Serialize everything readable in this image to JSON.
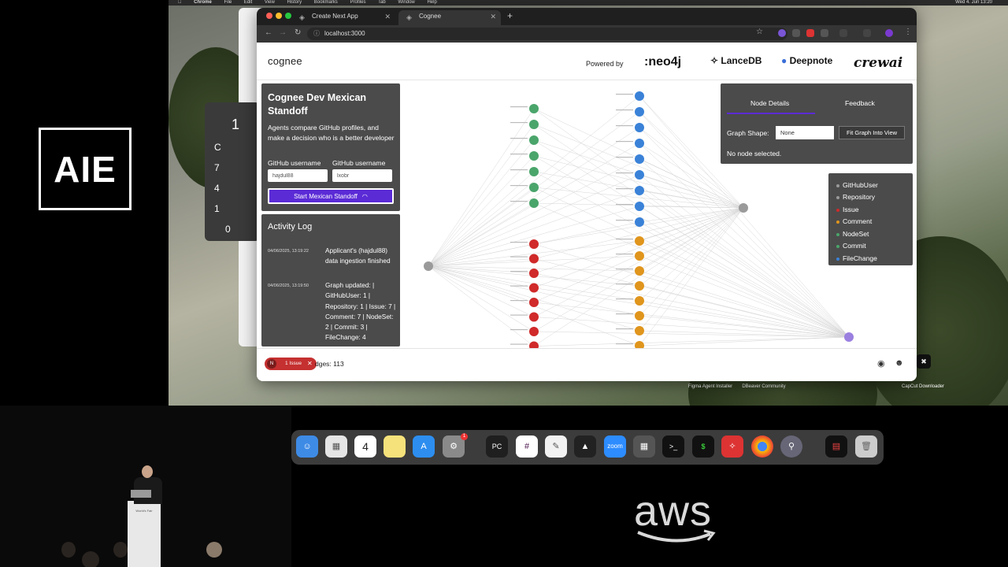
{
  "aie_logo": "AIE",
  "aws_logo": "aws",
  "podium_label": "World's Fair",
  "menubar": {
    "items": [
      "Chrome",
      "File",
      "Edit",
      "View",
      "History",
      "Bookmarks",
      "Profiles",
      "Tab",
      "Window",
      "Help"
    ],
    "clock": "Wed 4. Jun 13:20"
  },
  "background_window": {
    "calc_digits": [
      "1",
      "C",
      "7",
      "4",
      "1",
      "0"
    ]
  },
  "browser": {
    "tabs": [
      {
        "label": "Create Next App"
      },
      {
        "label": "Cognee"
      }
    ],
    "url": "localhost:3000"
  },
  "header": {
    "brand": "cognee",
    "powered_by": "Powered by",
    "sponsors": [
      ":neo4j",
      "LanceDB",
      "Deepnote",
      "crewai"
    ]
  },
  "standoff": {
    "title": "Cognee Dev Mexican Standoff",
    "description": "Agents compare GitHub profiles, and make a decision who is a better developer",
    "label_1": "GitHub username",
    "label_2": "GitHub username",
    "username_1": "hajdul88",
    "username_2": "lxobr",
    "start_label": "Start Mexican Standoff"
  },
  "activity": {
    "title": "Activity Log",
    "entries": [
      {
        "time": "04/06/2025, 13:19:22",
        "msg": "Applicant's (hajdul88) data ingestion finished"
      },
      {
        "time": "04/06/2025, 13:19:50",
        "msg": "Graph updated: | GitHubUser: 1 | Repository: 1 | Issue: 7 | Comment: 7 | NodeSet: 2 | Commit: 3 | FileChange: 4"
      }
    ]
  },
  "details": {
    "tab_details": "Node Details",
    "tab_feedback": "Feedback",
    "shape_label": "Graph Shape:",
    "shape_value": "None",
    "fit_label": "Fit Graph Into View",
    "empty": "No node selected."
  },
  "legend": {
    "items": [
      {
        "label": "GitHubUser",
        "color": "#9a9a9a"
      },
      {
        "label": "Repository",
        "color": "#9a9a9a"
      },
      {
        "label": "Issue",
        "color": "#d02a2a"
      },
      {
        "label": "Comment",
        "color": "#e0951c"
      },
      {
        "label": "NodeSet",
        "color": "#4aa56b"
      },
      {
        "label": "Commit",
        "color": "#4aa56b"
      },
      {
        "label": "FileChange",
        "color": "#3a82d8"
      }
    ]
  },
  "footer": {
    "issue_count": "N",
    "issue_label": "1 Issue",
    "edges": "dges: 113"
  },
  "desktop_icons": [
    {
      "label": "Figma Agent Installer"
    },
    {
      "label": "DBeaver Community"
    },
    {
      "label": "CapCut Downloader"
    }
  ],
  "dock": {
    "calendar_day": "4",
    "notification_badge": "1"
  },
  "colors": {
    "accent": "#5b2bd6",
    "panel": "#4b4b4b",
    "issue": "#d02a2a",
    "comment": "#e0951c",
    "green": "#4aa56b",
    "blue": "#3a82d8"
  }
}
